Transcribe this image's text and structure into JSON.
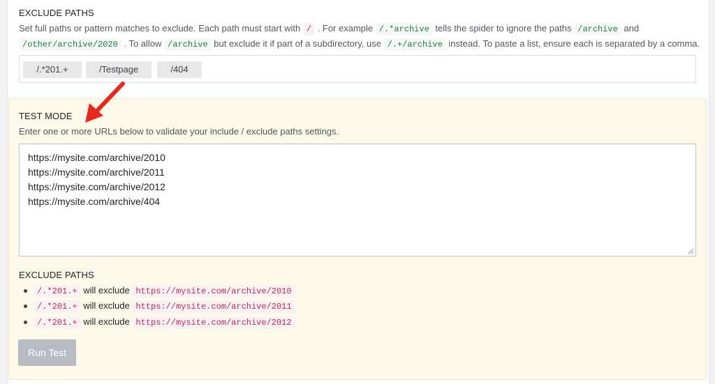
{
  "exclude": {
    "title": "EXCLUDE PATHS",
    "desc1_a": "Set full paths or pattern matches to exclude. Each path must start with",
    "code_slash": "/",
    "desc1_b": ". For example",
    "code_archive_pattern": "/.*archive",
    "desc1_c": "tells the spider to ignore the paths",
    "code_archive": "/archive",
    "desc1_d": "and",
    "code_other_archive": "/other/archive/2020",
    "desc2_a": ". To allow",
    "code_archive2": "/archive",
    "desc2_b": "but exclude it if part of a subdirectory, use",
    "code_subdir": "/.+/archive",
    "desc2_c": "instead. To paste a list, ensure each is separated by a comma.",
    "tags": [
      "/.*201.+",
      "/Testpage",
      "/404"
    ]
  },
  "test_mode": {
    "title": "TEST MODE",
    "description": "Enter one or more URLs below to validate your include / exclude paths settings.",
    "urls": [
      "https://mysite.com/archive/2010",
      "https://mysite.com/archive/2011",
      "https://mysite.com/archive/2012",
      "https://mysite.com/archive/404"
    ]
  },
  "results": {
    "title": "EXCLUDE PATHS",
    "items": [
      {
        "pattern": "/.*201.+",
        "text": "will exclude",
        "url": "https://mysite.com/archive/2010"
      },
      {
        "pattern": "/.*201.+",
        "text": "will exclude",
        "url": "https://mysite.com/archive/2011"
      },
      {
        "pattern": "/.*201.+",
        "text": "will exclude",
        "url": "https://mysite.com/archive/2012"
      }
    ]
  },
  "run_button": {
    "label": "Run Test"
  },
  "colors": {
    "accent_arrow": "#e8281f",
    "test_bg": "#fdf9e8"
  }
}
